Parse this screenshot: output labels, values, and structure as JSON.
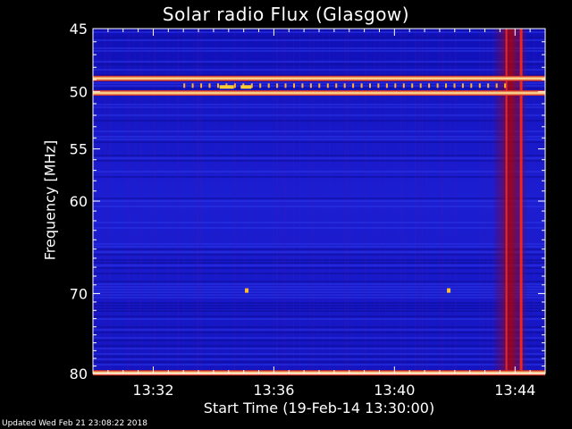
{
  "footer": {
    "updated": "Updated Wed Feb 21 23:08:22 2018"
  },
  "chart_data": {
    "type": "heatmap",
    "title": "Solar radio Flux (Glasgow)",
    "xlabel": "Start Time (19-Feb-14 13:30:00)",
    "ylabel": "Frequency [MHz]",
    "x_ticks": [
      "13:32",
      "13:36",
      "13:40",
      "13:44"
    ],
    "x_tick_minutes": [
      2,
      6,
      10,
      14
    ],
    "xlim_minutes": [
      0,
      15
    ],
    "y_ticks": [
      45,
      50,
      55,
      60,
      70,
      80
    ],
    "ylim": [
      45,
      80
    ],
    "y_scale": "log",
    "colormap": "blue-red-yellow",
    "features": [
      {
        "kind": "horizontal_line",
        "frequency_mhz": 48.9
      },
      {
        "kind": "horizontal_line",
        "frequency_mhz": 50.1
      },
      {
        "kind": "horizontal_line",
        "frequency_mhz": 79.9
      },
      {
        "kind": "vertical_burst",
        "minute_start": 13.3,
        "minute_end": 14.4
      },
      {
        "kind": "interference_dots",
        "frequency_mhz": 49.6,
        "minute_start": 3,
        "minute_end": 13.9
      },
      {
        "kind": "spot",
        "frequency_mhz": 69.6,
        "minute": 5.1
      },
      {
        "kind": "spot",
        "frequency_mhz": 69.6,
        "minute": 11.8
      }
    ],
    "colors": {
      "background": "#000000",
      "field": "#1a1ccc",
      "line": "#ffdd55",
      "burst": "#aa0000"
    }
  }
}
